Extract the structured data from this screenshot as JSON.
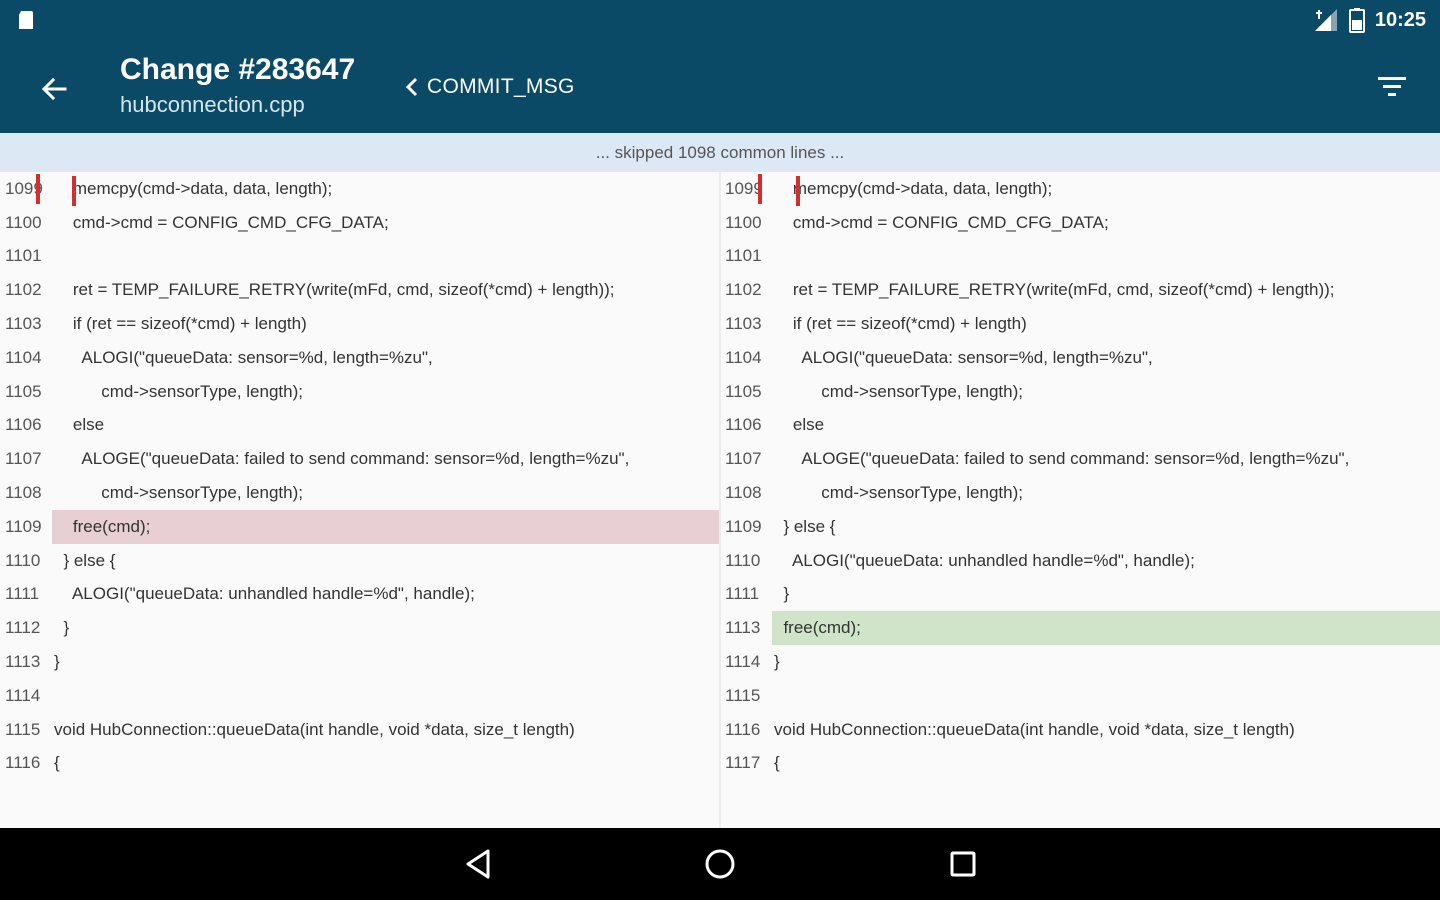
{
  "status_bar": {
    "time": "10:25",
    "icons": [
      "sd-card-icon",
      "signal-icon",
      "battery-icon"
    ]
  },
  "app_bar": {
    "title": "Change #283647",
    "subtitle": "hubconnection.cpp",
    "commit_nav_label": "COMMIT_MSG"
  },
  "skipped_banner": "... skipped 1098 common lines ...",
  "left_pane": {
    "rows": [
      {
        "ln": "1099",
        "code": "    memcpy(cmd->data, data, length);",
        "type": "normal"
      },
      {
        "ln": "1100",
        "code": "    cmd->cmd = CONFIG_CMD_CFG_DATA;",
        "type": "normal"
      },
      {
        "ln": "1101",
        "code": "",
        "type": "normal"
      },
      {
        "ln": "1102",
        "code": "    ret = TEMP_FAILURE_RETRY(write(mFd, cmd, sizeof(*cmd) + length));",
        "type": "normal"
      },
      {
        "ln": "1103",
        "code": "    if (ret == sizeof(*cmd) + length)",
        "type": "normal"
      },
      {
        "ln": "1104",
        "code": "      ALOGI(\"queueData: sensor=%d, length=%zu\",",
        "type": "normal"
      },
      {
        "ln": "1105",
        "code": "          cmd->sensorType, length);",
        "type": "normal"
      },
      {
        "ln": "1106",
        "code": "    else",
        "type": "normal"
      },
      {
        "ln": "1107",
        "code": "      ALOGE(\"queueData: failed to send command: sensor=%d, length=%zu\",",
        "type": "normal"
      },
      {
        "ln": "1108",
        "code": "          cmd->sensorType, length);",
        "type": "normal"
      },
      {
        "ln": "1109",
        "code": "    free(cmd);",
        "type": "removed"
      },
      {
        "ln": "1110",
        "code": "  } else {",
        "type": "normal"
      },
      {
        "ln": "1111",
        "code": "    ALOGI(\"queueData: unhandled handle=%d\", handle);",
        "type": "normal"
      },
      {
        "ln": "1112",
        "code": "  }",
        "type": "normal"
      },
      {
        "ln": "",
        "code": "",
        "type": "marker"
      },
      {
        "ln": "1113",
        "code": "}",
        "type": "normal"
      },
      {
        "ln": "1114",
        "code": "",
        "type": "normal"
      },
      {
        "ln": "1115",
        "code": "void HubConnection::queueData(int handle, void *data, size_t length)",
        "type": "normal"
      },
      {
        "ln": "1116",
        "code": "{",
        "type": "normal"
      }
    ]
  },
  "right_pane": {
    "rows": [
      {
        "ln": "1099",
        "code": "    memcpy(cmd->data, data, length);",
        "type": "normal"
      },
      {
        "ln": "1100",
        "code": "    cmd->cmd = CONFIG_CMD_CFG_DATA;",
        "type": "normal"
      },
      {
        "ln": "1101",
        "code": "",
        "type": "normal"
      },
      {
        "ln": "1102",
        "code": "    ret = TEMP_FAILURE_RETRY(write(mFd, cmd, sizeof(*cmd) + length));",
        "type": "normal"
      },
      {
        "ln": "1103",
        "code": "    if (ret == sizeof(*cmd) + length)",
        "type": "normal"
      },
      {
        "ln": "1104",
        "code": "      ALOGI(\"queueData: sensor=%d, length=%zu\",",
        "type": "normal"
      },
      {
        "ln": "1105",
        "code": "          cmd->sensorType, length);",
        "type": "normal"
      },
      {
        "ln": "1106",
        "code": "    else",
        "type": "normal"
      },
      {
        "ln": "1107",
        "code": "      ALOGE(\"queueData: failed to send command: sensor=%d, length=%zu\",",
        "type": "normal"
      },
      {
        "ln": "1108",
        "code": "          cmd->sensorType, length);",
        "type": "normal"
      },
      {
        "ln": "",
        "code": "",
        "type": "marker"
      },
      {
        "ln": "1109",
        "code": "  } else {",
        "type": "normal"
      },
      {
        "ln": "1110",
        "code": "    ALOGI(\"queueData: unhandled handle=%d\", handle);",
        "type": "normal"
      },
      {
        "ln": "1111",
        "code": "  }",
        "type": "normal"
      },
      {
        "ln": "1113",
        "code": "  free(cmd);",
        "type": "added"
      },
      {
        "ln": "1114",
        "code": "}",
        "type": "normal"
      },
      {
        "ln": "1115",
        "code": "",
        "type": "normal"
      },
      {
        "ln": "1116",
        "code": "void HubConnection::queueData(int handle, void *data, size_t length)",
        "type": "normal"
      },
      {
        "ln": "1117",
        "code": "{",
        "type": "normal"
      }
    ]
  },
  "colors": {
    "app_bar": "#0b4a66",
    "removed_line": "#e7cfd3",
    "added_line": "#cfe4c9",
    "skipped_banner": "#dce9f5",
    "change_marker": "#d32f2f"
  },
  "nav_bar": {
    "buttons": [
      "back-triangle-icon",
      "home-circle-icon",
      "recents-square-icon"
    ]
  }
}
